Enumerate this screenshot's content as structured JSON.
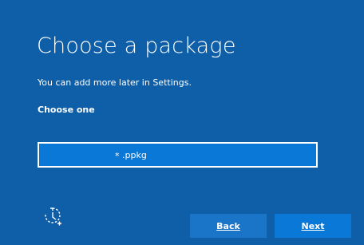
{
  "page": {
    "title": "Choose a package",
    "subtitle": "You can add more later in Settings.",
    "section_label": "Choose one"
  },
  "package_list": {
    "items": [
      {
        "star": "*",
        "name": ".ppkg",
        "selected": true
      }
    ]
  },
  "footer": {
    "accessibility_icon": "ease-of-access-icon",
    "back_label": "Back",
    "next_label": "Next"
  },
  "colors": {
    "background": "#0f5ea8",
    "selected_item": "#0a78d6",
    "back_button": "#1a74c8",
    "next_button": "#0a78d6",
    "text": "#ffffff"
  }
}
